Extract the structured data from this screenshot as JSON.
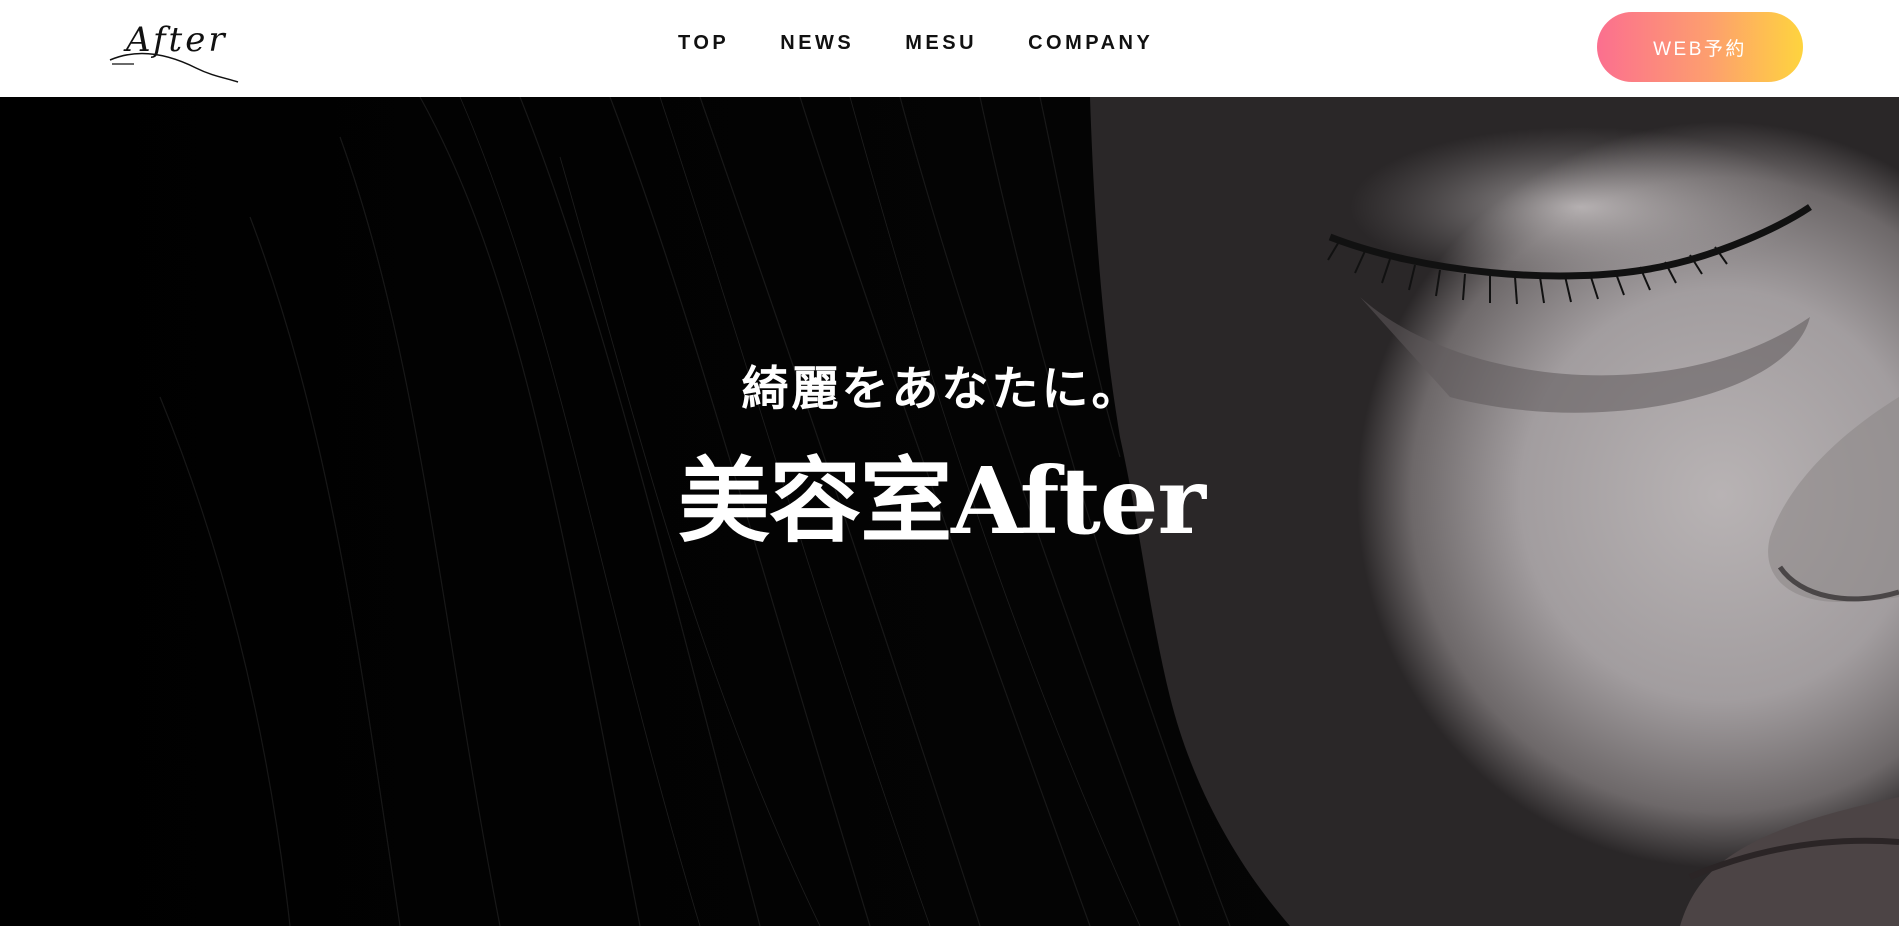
{
  "header": {
    "logo": {
      "text": "After"
    },
    "nav": [
      {
        "label": "TOP"
      },
      {
        "label": "NEWS"
      },
      {
        "label": "MESU"
      },
      {
        "label": "COMPANY"
      }
    ],
    "reserve_button": {
      "label": "WEB予約"
    }
  },
  "hero": {
    "tagline": "綺麗をあなたに。",
    "title": "美容室After",
    "image": "monochrome-woman-closed-eye-photo"
  },
  "colors": {
    "header_bg": "#ffffff",
    "nav_text": "#111111",
    "button_gradient_start": "#fb6f8f",
    "button_gradient_end": "#fed43e",
    "hero_bg": "#000000",
    "hero_text": "#ffffff"
  }
}
